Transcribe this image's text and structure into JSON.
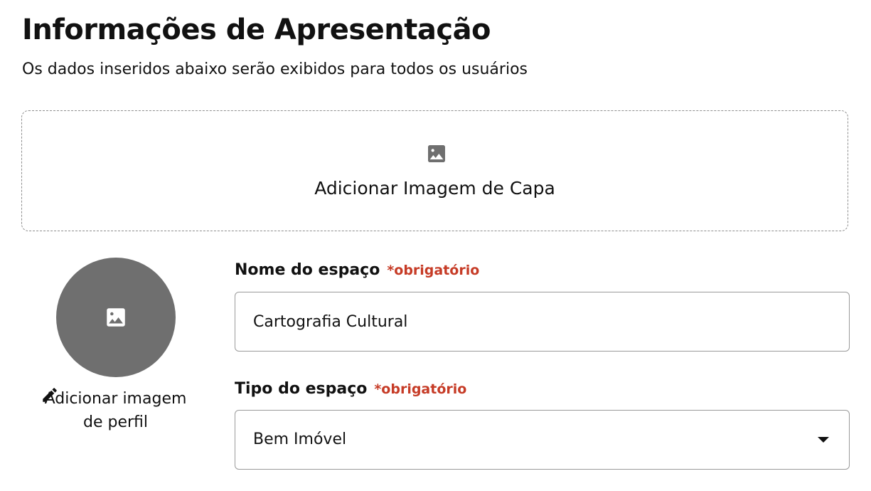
{
  "header": {
    "title": "Informações de Apresentação",
    "subtitle": "Os dados inseridos abaixo serão exibidos para todos os usuários"
  },
  "cover": {
    "label": "Adicionar Imagem de Capa",
    "icon": "image-icon"
  },
  "profile": {
    "edit_label": "Adicionar imagem de perfil",
    "icon": "image-icon",
    "edit_icon": "pencil-icon"
  },
  "fields": {
    "name": {
      "label": "Nome do espaço",
      "required": "*obrigatório",
      "value": "Cartografia Cultural"
    },
    "type": {
      "label": "Tipo do espaço",
      "required": "*obrigatório",
      "value": "Bem Imóvel"
    }
  },
  "colors": {
    "required": "#c63b26",
    "avatar_bg": "#6f6f6f",
    "border": "#9a9a9a"
  }
}
